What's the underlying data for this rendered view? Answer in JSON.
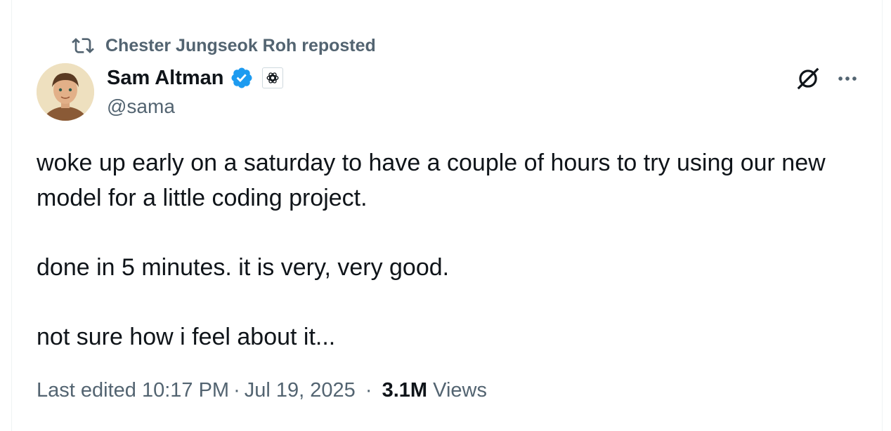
{
  "social_context": {
    "icon": "repost-icon",
    "text": "Chester Jungseok Roh reposted"
  },
  "author": {
    "display_name": "Sam Altman",
    "handle": "@sama",
    "verified_badge_color": "#1d9bf0",
    "affiliate_badge": "openai-logo-icon"
  },
  "actions": {
    "grok_icon": "grok-icon",
    "more_icon": "more-options-icon"
  },
  "tweet": {
    "paragraphs": [
      "woke up early on a saturday to have a couple of hours to try using our new model for a little coding project.",
      "done in 5 minutes. it is very, very good.",
      "not sure how i feel about it..."
    ]
  },
  "meta": {
    "edited_prefix": "Last edited",
    "time": "10:17 PM",
    "date": "Jul 19, 2025",
    "separator": "·",
    "views_count": "3.1M",
    "views_label": "Views"
  },
  "colors": {
    "text_primary": "#0f1419",
    "text_secondary": "#536471",
    "accent": "#1d9bf0"
  }
}
